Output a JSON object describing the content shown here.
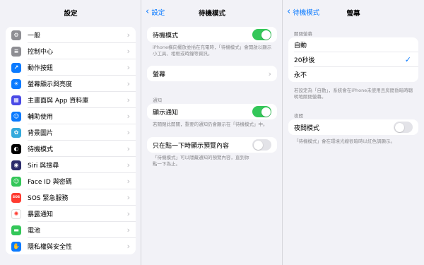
{
  "settings": {
    "title": "設定",
    "items": [
      {
        "label": "一般",
        "icon": "gear-icon",
        "color": "#8e8e93",
        "glyph": "⚙"
      },
      {
        "label": "控制中心",
        "icon": "control-center-icon",
        "color": "#8e8e93",
        "glyph": "≡"
      },
      {
        "label": "動作按鈕",
        "icon": "action-button-icon",
        "color": "#0a7aff",
        "glyph": "↗"
      },
      {
        "label": "螢幕顯示與亮度",
        "icon": "brightness-icon",
        "color": "#0a7aff",
        "glyph": "☀"
      },
      {
        "label": "主畫面與 App 資料庫",
        "icon": "home-screen-icon",
        "color": "#4a4ae6",
        "glyph": "▦"
      },
      {
        "label": "輔助使用",
        "icon": "accessibility-icon",
        "color": "#0a7aff",
        "glyph": "☺"
      },
      {
        "label": "背景圖片",
        "icon": "wallpaper-icon",
        "color": "#34aadc",
        "glyph": "✿"
      },
      {
        "label": "待機模式",
        "icon": "standby-icon",
        "color": "#000000",
        "glyph": "◐"
      },
      {
        "label": "Siri 與搜尋",
        "icon": "siri-icon",
        "color": "#2b2b6b",
        "glyph": "◉"
      },
      {
        "label": "Face ID 與密碼",
        "icon": "face-id-icon",
        "color": "#34c759",
        "glyph": "☺"
      },
      {
        "label": "SOS 緊急服務",
        "icon": "sos-icon",
        "color": "#ff3b30",
        "glyph": "SOS"
      },
      {
        "label": "暴露通知",
        "icon": "exposure-icon",
        "color": "#ffffff",
        "glyph": "✺"
      },
      {
        "label": "電池",
        "icon": "battery-icon",
        "color": "#34c759",
        "glyph": "▬"
      },
      {
        "label": "隱私權與安全性",
        "icon": "hand-icon",
        "color": "#0a7aff",
        "glyph": "✋"
      }
    ]
  },
  "standby": {
    "back_label": "設定",
    "title": "待機模式",
    "main_toggle_label": "待機模式",
    "main_toggle_on": true,
    "main_footer": "iPhone橫向擺放並插在充電時，「待機模式」會開啟以顯示小工具、相框或時鐘等資訊。",
    "display_label": "螢幕",
    "notif_header": "通知",
    "show_notif_label": "顯示通知",
    "show_notif_on": true,
    "show_notif_footer": "若關閉此開關，重要的通知仍會顯示在「待機模式」中。",
    "preview_label": "只在點一下時顯示預覽內容",
    "preview_on": false,
    "preview_footer": "「待機模式」可以隱藏通知的預覽內容，直到你點一下為止。"
  },
  "display": {
    "back_label": "待機模式",
    "title": "螢幕",
    "auto_off_header": "關閉螢幕",
    "options": [
      "自動",
      "20秒後",
      "永不"
    ],
    "selected_index": 1,
    "auto_footer": "若設定為「自動」，系統會在iPhone未使用且房間昏暗時聰明地關閉螢幕。",
    "night_header": "夜間",
    "night_label": "夜間模式",
    "night_on": false,
    "night_footer": "「待機模式」會在環境光線很暗時以紅色調顯示。"
  }
}
